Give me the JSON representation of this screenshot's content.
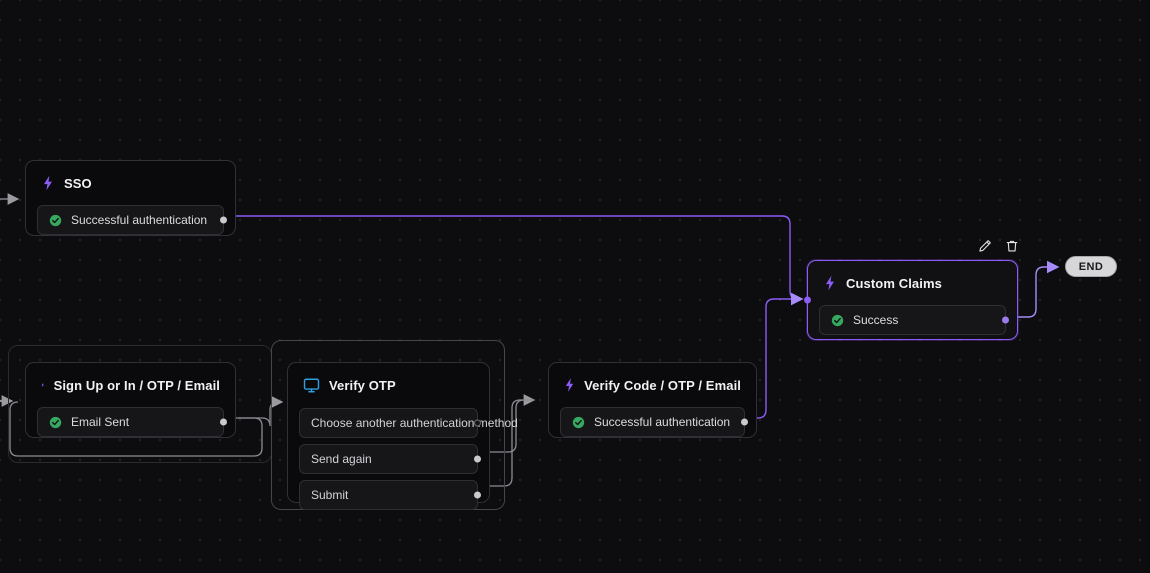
{
  "canvas": {
    "background_color": "#0d0d0f",
    "grid_dot_color": "#2b2b30",
    "accent_color": "#8b5cf6",
    "edge_color_default": "#8f8f96",
    "edge_color_active": "#8b5cf6",
    "success_color": "#37a860"
  },
  "toolbar": {
    "edit_label": "Edit",
    "delete_label": "Delete",
    "edit_icon": "pencil-icon",
    "delete_icon": "trash-icon"
  },
  "nodes": [
    {
      "id": "sso",
      "title": "SSO",
      "icon": "bolt-icon",
      "selected": false,
      "rows": [
        {
          "label": "Successful authentication",
          "icon": "check-circle-icon",
          "handle": "filled"
        }
      ]
    },
    {
      "id": "signup",
      "title": "Sign Up or In / OTP / Email",
      "icon": "bolt-icon",
      "selected": false,
      "rows": [
        {
          "label": "Email Sent",
          "icon": "check-circle-icon",
          "handle": "filled"
        }
      ]
    },
    {
      "id": "verify-otp",
      "title": "Verify OTP",
      "icon": "screen-icon",
      "selected": false,
      "rows": [
        {
          "label": "Choose another authentication method",
          "icon": "none",
          "handle": "hollow"
        },
        {
          "label": "Send again",
          "icon": "none",
          "handle": "filled"
        },
        {
          "label": "Submit",
          "icon": "none",
          "handle": "filled"
        }
      ]
    },
    {
      "id": "verify-code",
      "title": "Verify Code / OTP / Email",
      "icon": "bolt-icon",
      "selected": false,
      "rows": [
        {
          "label": "Successful authentication",
          "icon": "check-circle-icon",
          "handle": "filled"
        }
      ]
    },
    {
      "id": "custom-claims",
      "title": "Custom Claims",
      "icon": "bolt-icon",
      "selected": true,
      "rows": [
        {
          "label": "Success",
          "icon": "check-circle-icon",
          "handle": "purple"
        }
      ]
    }
  ],
  "end_node": {
    "label": "END"
  }
}
